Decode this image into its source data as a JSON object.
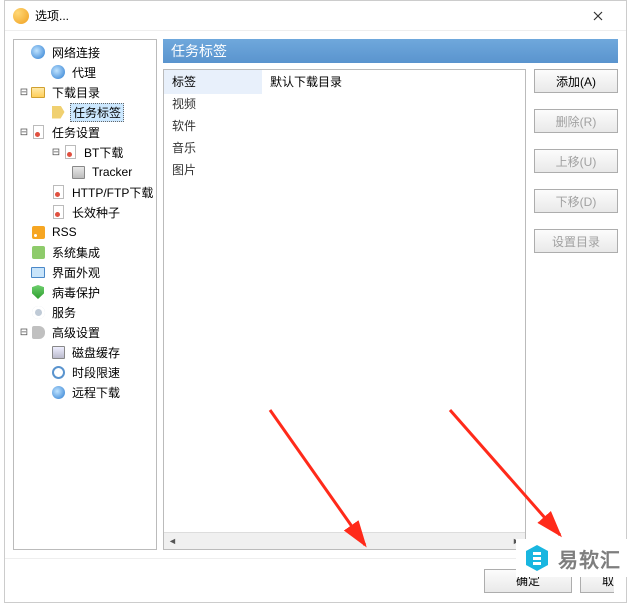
{
  "window": {
    "title": "选项..."
  },
  "tree": {
    "items": [
      {
        "label": "网络连接",
        "icon": "globe",
        "level": 0,
        "expander": ""
      },
      {
        "label": "代理",
        "icon": "globe",
        "level": 1,
        "expander": ""
      },
      {
        "label": "下载目录",
        "icon": "folder-open",
        "level": 0,
        "expander": "minus"
      },
      {
        "label": "任务标签",
        "icon": "tag",
        "level": 1,
        "selected": true,
        "expander": ""
      },
      {
        "label": "任务设置",
        "icon": "page-red",
        "level": 0,
        "expander": "minus"
      },
      {
        "label": "BT下载",
        "icon": "page-red",
        "level": 1,
        "expander": "minus"
      },
      {
        "label": "Tracker",
        "icon": "server",
        "level": 2,
        "expander": ""
      },
      {
        "label": "HTTP/FTP下载",
        "icon": "page-red",
        "level": 1,
        "expander": ""
      },
      {
        "label": "长效种子",
        "icon": "page-red",
        "level": 1,
        "expander": ""
      },
      {
        "label": "RSS",
        "icon": "rss",
        "level": 0,
        "expander": ""
      },
      {
        "label": "系统集成",
        "icon": "puzzle",
        "level": 0,
        "expander": ""
      },
      {
        "label": "界面外观",
        "icon": "monitor",
        "level": 0,
        "expander": ""
      },
      {
        "label": "病毒保护",
        "icon": "shield",
        "level": 0,
        "expander": ""
      },
      {
        "label": "服务",
        "icon": "gear",
        "level": 0,
        "expander": ""
      },
      {
        "label": "高级设置",
        "icon": "wrench",
        "level": 0,
        "expander": "minus"
      },
      {
        "label": "磁盘缓存",
        "icon": "disk",
        "level": 1,
        "expander": ""
      },
      {
        "label": "时段限速",
        "icon": "clock",
        "level": 1,
        "expander": ""
      },
      {
        "label": "远程下载",
        "icon": "remote",
        "level": 1,
        "expander": ""
      }
    ]
  },
  "panel": {
    "header": "任务标签",
    "columns": {
      "label": "标签",
      "dir": "默认下载目录"
    },
    "rows": [
      {
        "label": "视频",
        "dir": ""
      },
      {
        "label": "软件",
        "dir": ""
      },
      {
        "label": "音乐",
        "dir": ""
      },
      {
        "label": "图片",
        "dir": ""
      }
    ]
  },
  "buttons": {
    "add": "添加(A)",
    "delete": "删除(R)",
    "moveup": "上移(U)",
    "movedown": "下移(D)",
    "setdir": "设置目录",
    "ok": "确定",
    "cancel": "取"
  },
  "logo": "易软汇"
}
